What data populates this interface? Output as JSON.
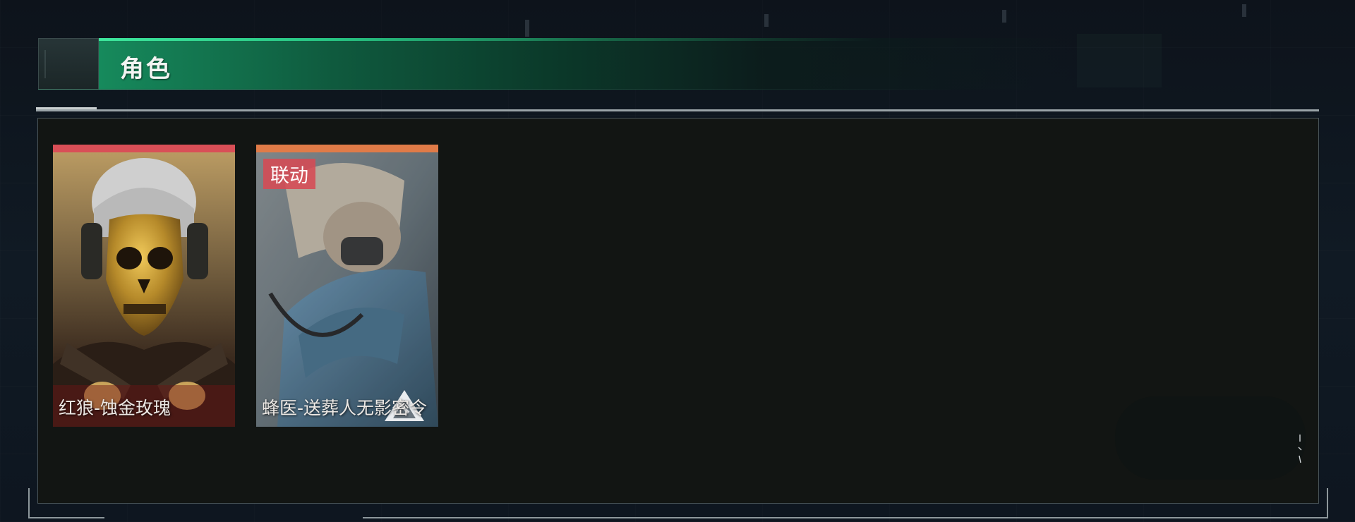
{
  "header": {
    "title": "角色"
  },
  "characters": [
    {
      "name": "红狼-蚀金玫瑰",
      "tag": "",
      "rarity_color": "#d94f57"
    },
    {
      "name": "蜂医-送葬人无影密令",
      "tag": "联动",
      "rarity_color": "#e07b48"
    }
  ],
  "colors": {
    "accent": "#27c483",
    "panel_bg": "#121513",
    "rarity_red": "#d94f57",
    "rarity_orange": "#e07b48",
    "tag_bg": "#d64a54"
  },
  "icons": [
    "character-portrait",
    "link-badge",
    "emblem-icon"
  ]
}
